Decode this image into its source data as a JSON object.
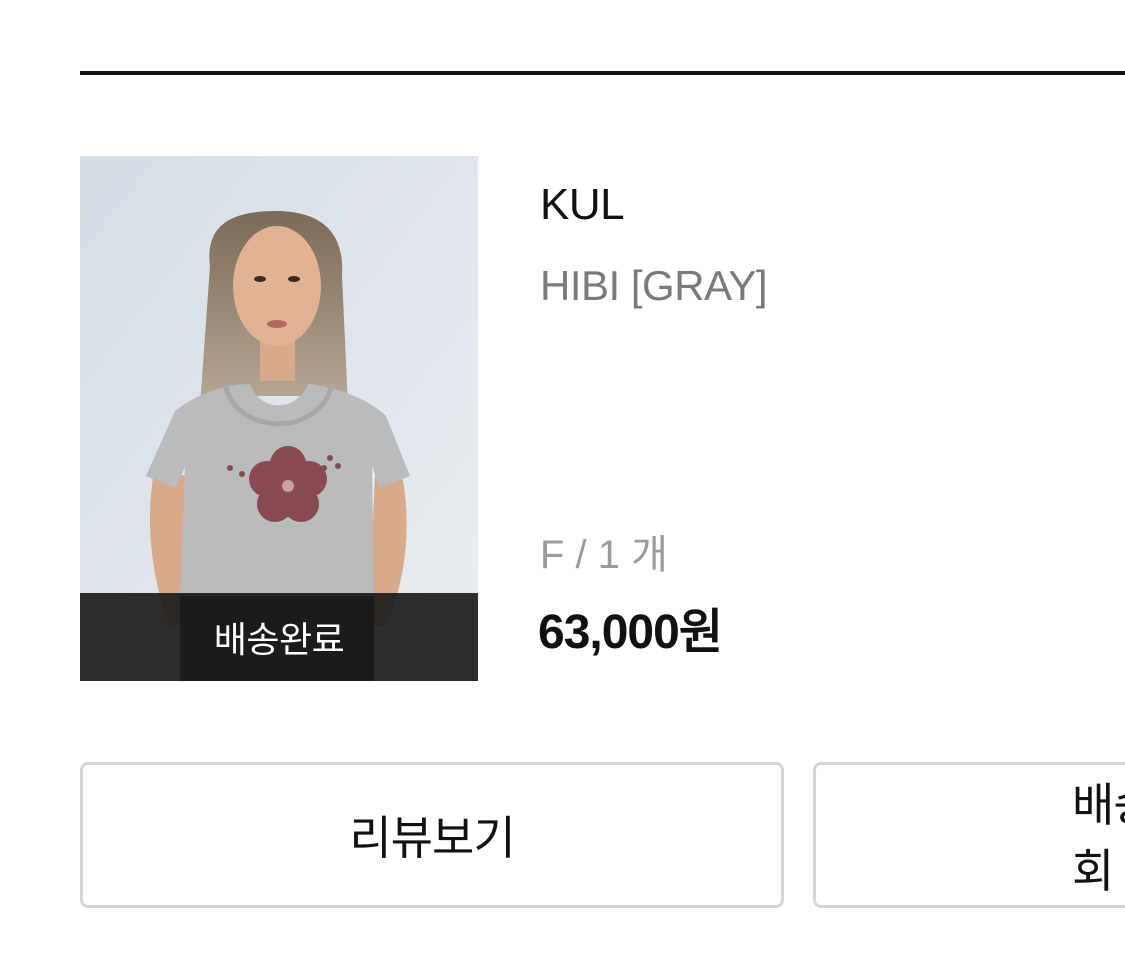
{
  "order_item": {
    "status": "배송완료",
    "brand": "KUL",
    "product_name": "HIBI [GRAY]",
    "option": "F / 1 개",
    "price": "63,000원"
  },
  "actions": {
    "review_label": "리뷰보기",
    "delivery_label": "배송조회"
  },
  "colors": {
    "divider": "#111111",
    "secondary_text": "#7a7a7a",
    "button_border": "#d4d4d4",
    "status_overlay": "#1c1c1c"
  }
}
